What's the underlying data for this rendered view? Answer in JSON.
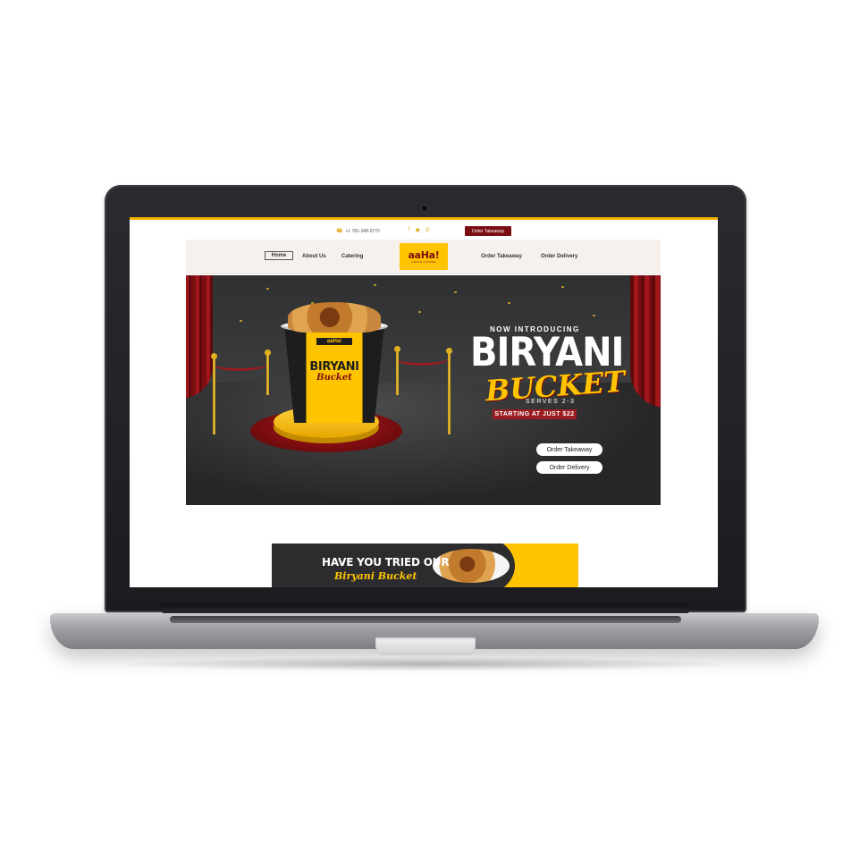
{
  "utility_bar": {
    "phone": "+1 781-348-9770",
    "order_button": "Order Takeaway"
  },
  "nav": {
    "items": [
      "Home",
      "About Us",
      "Catering"
    ],
    "items_right": [
      "Order Takeaway",
      "Order Delivery"
    ],
    "logo_text": "aaHa!",
    "logo_sub": "INDIAN CUISINE"
  },
  "hero": {
    "kicker": "NOW INTRODUCING",
    "title": "BIRYANI",
    "subtitle": "BUCKET",
    "serves": "SERVES 2-3",
    "price": "STARTING AT JUST $22",
    "buttons": [
      "Order Takeaway",
      "Order Delivery"
    ],
    "bucket_logo": "aaHa!",
    "bucket_title": "BIRYANI",
    "bucket_script": "Bucket"
  },
  "promo": {
    "line1": "HAVE YOU TRIED OUR",
    "line2": "Biryani Bucket"
  },
  "colors": {
    "brand_yellow": "#ffc400",
    "brand_maroon": "#7a0e12",
    "hero_bg": "#333436"
  }
}
